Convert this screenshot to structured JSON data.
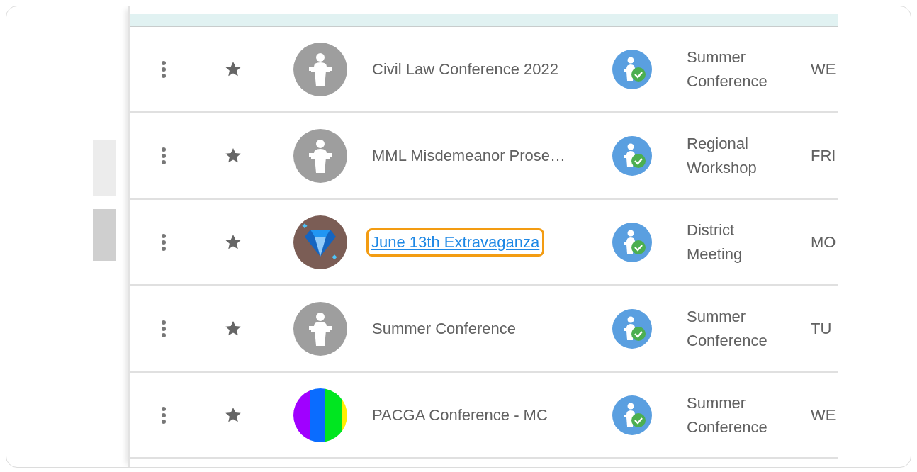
{
  "table": {
    "rows": [
      {
        "kind": "podium",
        "name": "Civil Law Conference 2022",
        "link": false,
        "type": "Summer Conference",
        "day": "WE"
      },
      {
        "kind": "podium",
        "name": "MML Misdemeanor Prose…",
        "link": false,
        "type": "Regional Workshop",
        "day": "FRI"
      },
      {
        "kind": "diamond",
        "name": "June 13th Extravaganza",
        "link": true,
        "type": "District Meeting",
        "day": "MO"
      },
      {
        "kind": "podium",
        "name": "Summer Conference",
        "link": false,
        "type": "Summer Conference",
        "day": "TU"
      },
      {
        "kind": "stripes",
        "name": "PACGA Conference - MC",
        "link": false,
        "type": "Summer Conference",
        "day": "WE"
      }
    ]
  }
}
